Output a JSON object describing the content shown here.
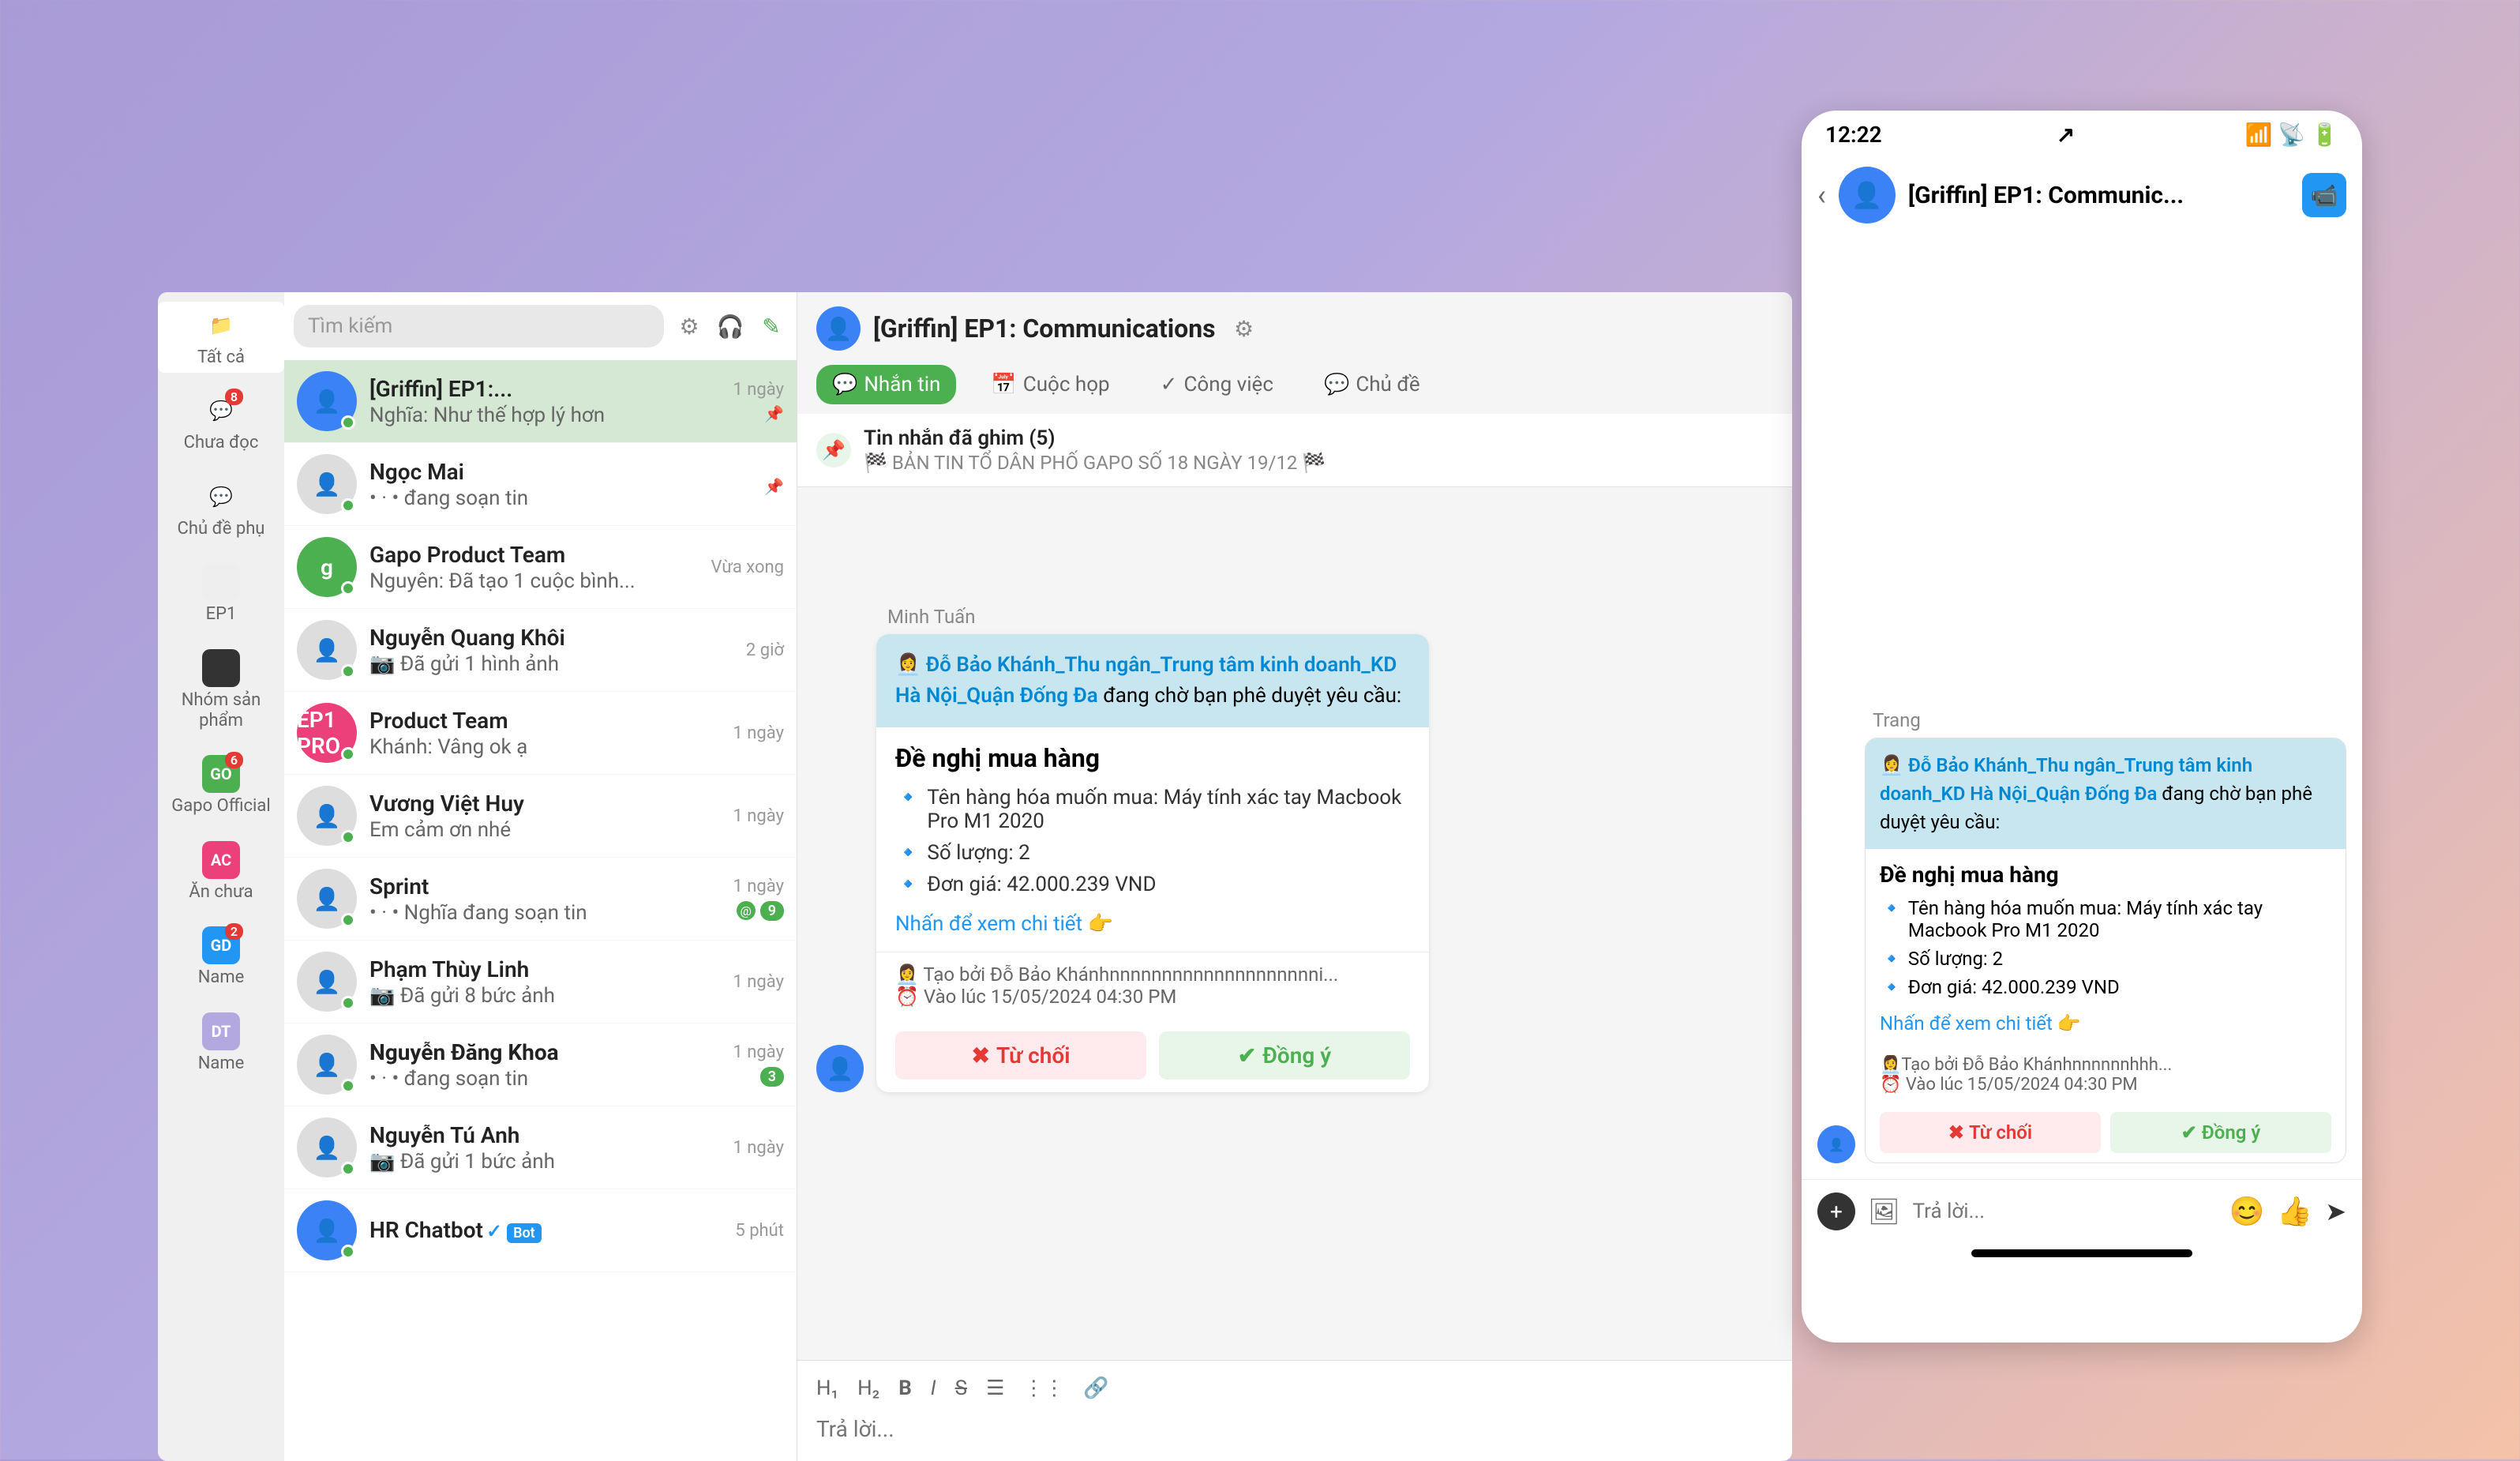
{
  "search": {
    "placeholder": "Tìm kiếm"
  },
  "sidebar": [
    {
      "label": "Tất cả",
      "icon": "📁",
      "color": "#2196f3",
      "badge": null
    },
    {
      "label": "Chưa đọc",
      "icon": "💬",
      "color": "#4caf50",
      "badge": "8"
    },
    {
      "label": "Chủ đề phụ",
      "icon": "💬",
      "color": "#4caf50",
      "badge": null
    },
    {
      "label": "EP1",
      "icon": "",
      "color": "#9e9e9e",
      "badge": null
    },
    {
      "label": "Nhóm sản phẩm",
      "icon": "",
      "color": "#333",
      "badge": null
    },
    {
      "label": "Gapo Official",
      "icon": "GO",
      "color": "#4caf50",
      "badge": "6"
    },
    {
      "label": "Ăn chưa",
      "icon": "AC",
      "color": "#ec407a",
      "badge": null
    },
    {
      "label": "Name",
      "icon": "GD",
      "color": "#2196f3",
      "badge": "2"
    },
    {
      "label": "Name",
      "icon": "DT",
      "color": "#b4a8e0",
      "badge": null
    }
  ],
  "chats": [
    {
      "name": "[Griffin] EP1:...",
      "preview": "Nghĩa: Như thế hợp lý hơn",
      "time": "1 ngày",
      "pinned": true,
      "avatar": "blue",
      "icon": "👤"
    },
    {
      "name": "Ngọc Mai",
      "preview": "• · • đang soạn tin",
      "time": "",
      "pinned": true,
      "avatar": "img"
    },
    {
      "name": "Gapo Product Team",
      "preview": "Nguyên: Đã tạo 1 cuộc bình...",
      "time": "Vừa xong",
      "avatar": "green",
      "icon": "g"
    },
    {
      "name": "Nguyễn Quang Khôi",
      "preview": "📷 Đã gửi 1 hình ảnh",
      "time": "2 giờ",
      "avatar": "img"
    },
    {
      "name": "Product Team",
      "preview": "Khánh: Vâng ok ạ",
      "time": "1 ngày",
      "avatar": "pink",
      "icon": "EP1 PRO"
    },
    {
      "name": "Vương Việt Huy",
      "preview": "Em cảm ơn nhé",
      "time": "1 ngày",
      "avatar": "img"
    },
    {
      "name": "Sprint",
      "preview": "• · • Nghĩa đang soạn tin",
      "time": "1 ngày",
      "avatar": "img",
      "badges": true,
      "count": "9"
    },
    {
      "name": "Phạm Thùy Linh",
      "preview": "📷 Đã gửi 8 bức ảnh",
      "time": "1 ngày",
      "avatar": "img"
    },
    {
      "name": "Nguyễn Đăng Khoa",
      "preview": "• · • đang soạn tin",
      "time": "1 ngày",
      "bold": true,
      "avatar": "img",
      "count": "3"
    },
    {
      "name": "Nguyễn Tú Anh",
      "preview": "📷 Đã gửi 1 bức ảnh",
      "time": "1 ngày",
      "avatar": "img"
    },
    {
      "name": "HR Chatbot",
      "preview": "",
      "time": "5 phút",
      "bot": true,
      "verified": true,
      "avatar": "blue"
    }
  ],
  "header": {
    "title": "[Griffin] EP1: Communications"
  },
  "tabs": [
    {
      "label": "Nhắn tin",
      "icon": "💬",
      "active": true
    },
    {
      "label": "Cuộc họp",
      "icon": "📅"
    },
    {
      "label": "Công việc",
      "icon": "✓"
    },
    {
      "label": "Chủ đề",
      "icon": "💬"
    }
  ],
  "pinned": {
    "title": "Tin nhắn đã ghim (5)",
    "text": "🏁 BẢN TIN TỔ DÂN PHỐ GAPO SỐ 18 NGÀY 19/12 🏁"
  },
  "message": {
    "sender": "Minh Tuấn",
    "headerPrefix": "👩‍💼 ",
    "headerLink": "Đỗ Bảo Khánh_Thu ngân_Trung tâm kinh doanh_KD Hà Nội_Quận Đống Đa",
    "headerSuffix": " đang chờ bạn phê duyệt yêu cầu:",
    "title": "Đề nghị mua hàng",
    "lines": [
      "Tên hàng hóa muốn mua: Máy tính xác tay Macbook Pro M1 2020",
      "Số lượng: 2",
      "Đơn giá: 42.000.239 VND"
    ],
    "link": "Nhấn để xem chi tiết 👉",
    "meta1": "👩‍💼 Tạo bởi Đỗ Bảo Khánhnnnnnnnnnnnnnnnnnnnni...",
    "meta2": "⏰ Vào lúc 15/05/2024 04:30 PM",
    "reject": "Từ chối",
    "accept": "Đồng ý"
  },
  "composer": {
    "placeholder": "Trả lời..."
  },
  "format": [
    "H₁",
    "H₂",
    "B",
    "I",
    "S"
  ],
  "mobile": {
    "time": "12:22",
    "title": "[Griffin] EP1: Communic...",
    "sender": "Trang",
    "meta1": "👩‍💼Tạo bởi Đỗ Bảo Khánhnnnnnnhhh...",
    "meta2": "⏰ Vào lúc 15/05/2024 04:30 PM",
    "placeholder": "Trả lời..."
  }
}
